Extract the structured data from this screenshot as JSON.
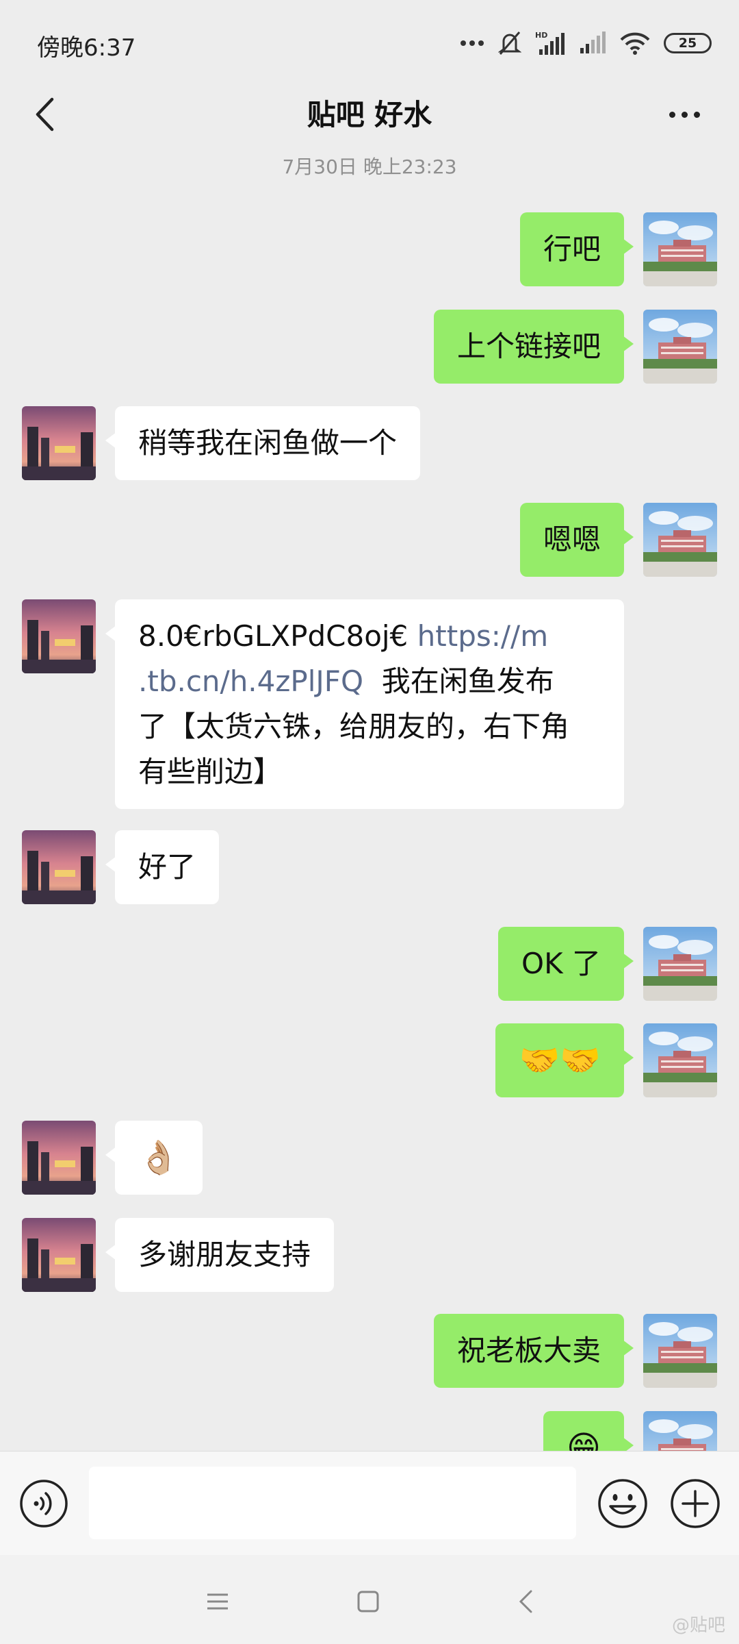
{
  "status_bar": {
    "time": "傍晚6:37",
    "battery": "25"
  },
  "header": {
    "title": "贴吧 好水"
  },
  "timestamp": "7月30日 晚上23:23",
  "messages": [
    {
      "dir": "out",
      "text": "行吧"
    },
    {
      "dir": "out",
      "text": "上个链接吧"
    },
    {
      "dir": "in",
      "text": "稍等我在闲鱼做一个"
    },
    {
      "dir": "out",
      "text": "嗯嗯"
    },
    {
      "dir": "in",
      "line1_code": "8.0€rbGLXPdC8oj€ ",
      "line1_link": "https://m",
      "line2_link": ".tb.cn/h.4zPlJFQ",
      "line2_text": "  我在闲鱼发布",
      "line3": "了【太货六铢，给朋友的，右下角",
      "line4": "有些削边】"
    },
    {
      "dir": "in",
      "text": "好了"
    },
    {
      "dir": "out",
      "text": "OK 了"
    },
    {
      "dir": "out",
      "text": "🤝🤝"
    },
    {
      "dir": "in",
      "text": "👌🏼"
    },
    {
      "dir": "in",
      "text": "多谢朋友支持"
    },
    {
      "dir": "out",
      "text": "祝老板大卖"
    },
    {
      "dir": "out",
      "text": "😁"
    }
  ],
  "input": {
    "value": ""
  },
  "watermark": "@贴吧",
  "icons": {
    "back": "back-arrow-icon",
    "more": "more-dots-icon",
    "voice": "voice-icon",
    "emoji": "emoji-icon",
    "plus": "plus-icon"
  },
  "colors": {
    "outgoing_bubble": "#95EC69",
    "incoming_bubble": "#FFFFFF",
    "background": "#EDEDED",
    "link": "#5B6B8C"
  }
}
